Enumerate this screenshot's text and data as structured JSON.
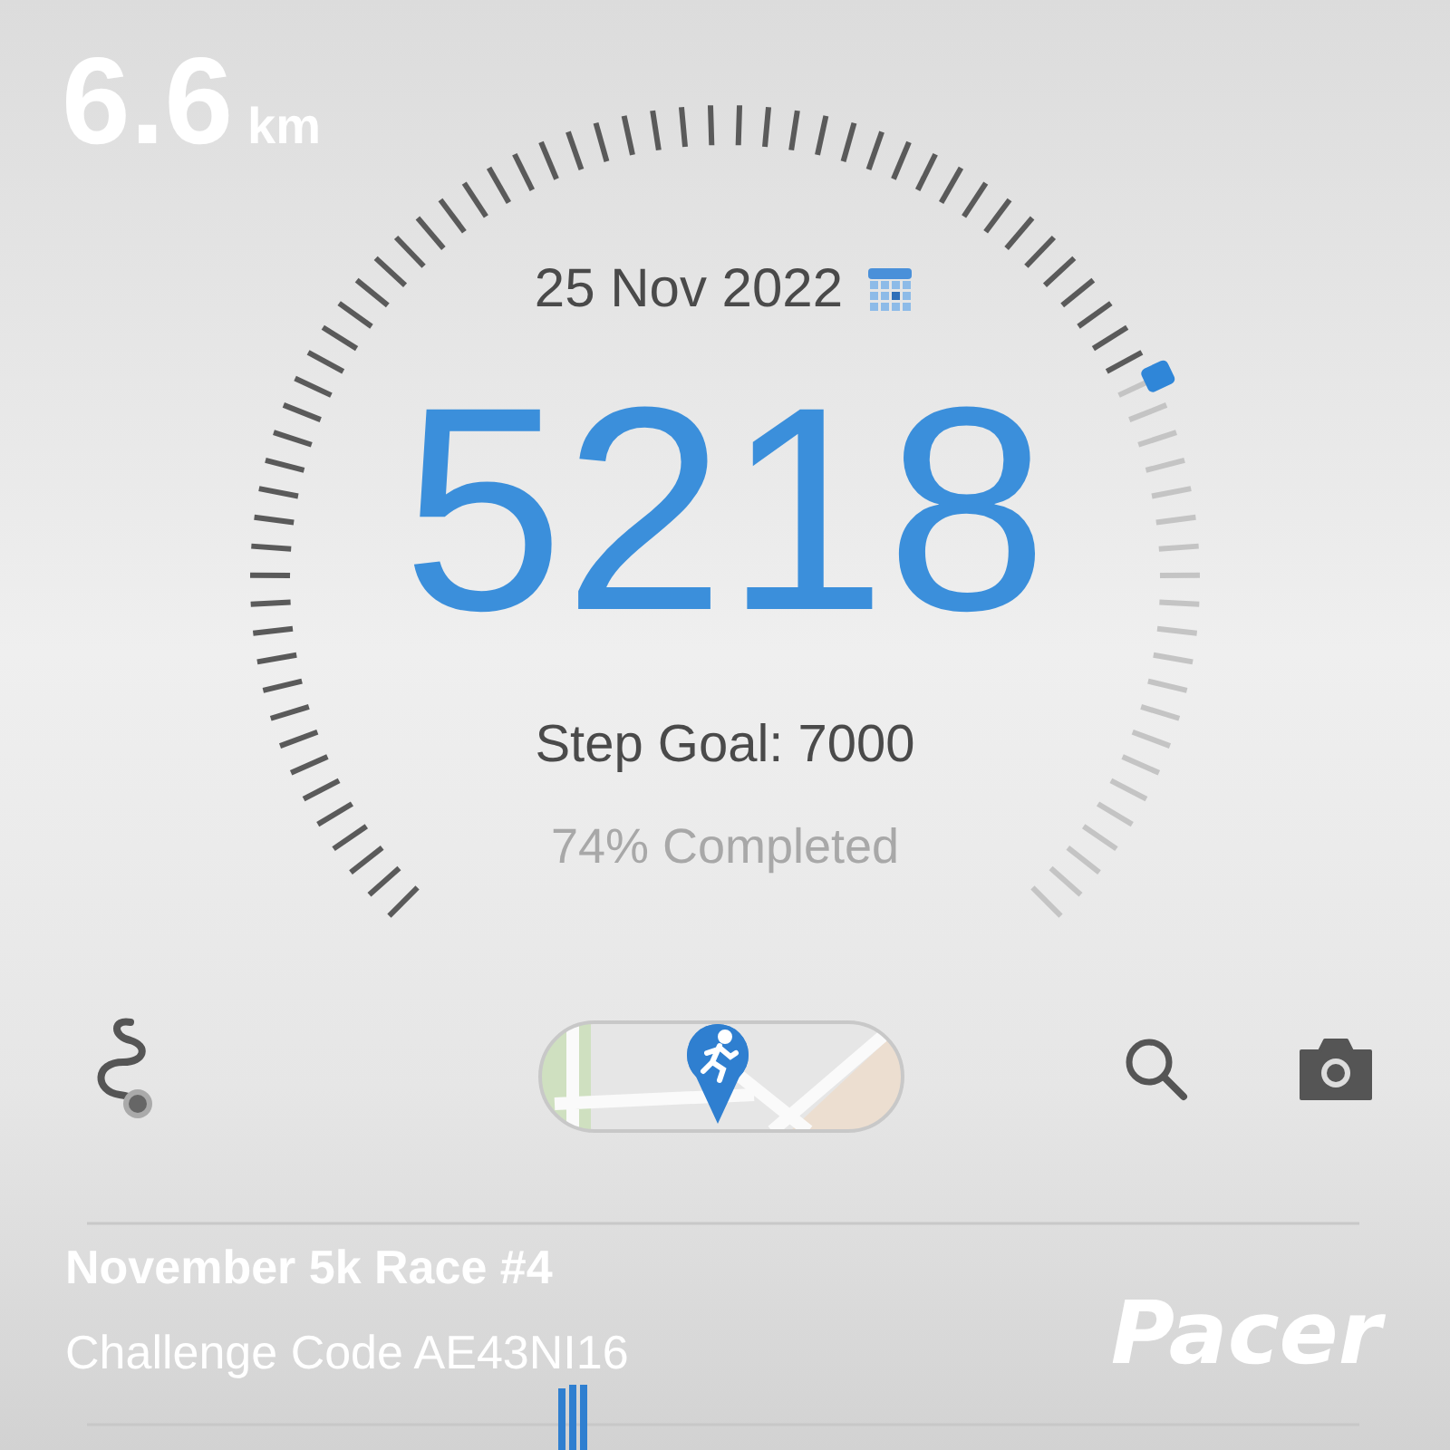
{
  "distance": {
    "value": "6.6",
    "unit": "km"
  },
  "gauge": {
    "date": "25 Nov 2022",
    "steps": "5218",
    "goal": "Step Goal: 7000",
    "completed": "74% Completed"
  },
  "challenge": {
    "title": "November 5k Race #4",
    "code": "Challenge Code AE43NI16"
  },
  "brand": "Pacer"
}
